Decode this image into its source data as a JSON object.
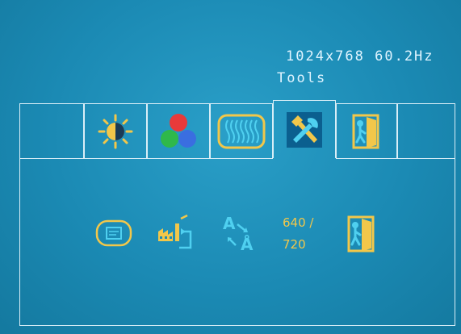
{
  "header": {
    "resolution": "1024x768 60.2Hz",
    "menu_title": "Tools"
  },
  "tabs": [
    {
      "icon": "blank-tab",
      "active": false
    },
    {
      "icon": "brightness-contrast-icon",
      "active": false
    },
    {
      "icon": "color-rgb-icon",
      "active": false
    },
    {
      "icon": "image-waves-icon",
      "active": false
    },
    {
      "icon": "tools-icon",
      "active": true
    },
    {
      "icon": "exit-door-icon",
      "active": false
    },
    {
      "icon": "blank-tab",
      "active": false
    }
  ],
  "tools": {
    "items": [
      {
        "icon": "osd-settings-icon"
      },
      {
        "icon": "factory-reset-icon"
      },
      {
        "icon": "language-icon"
      },
      {
        "icon": "resolution-mode",
        "label_line1": "640 /",
        "label_line2": "720"
      },
      {
        "icon": "exit-door-icon"
      }
    ]
  },
  "colors": {
    "background": "#1b8ab4",
    "border": "#d9eef7",
    "icon_yellow": "#f2c74a",
    "icon_cyan": "#4fd0f0",
    "active_tab_bg": "#0e6fa3"
  }
}
